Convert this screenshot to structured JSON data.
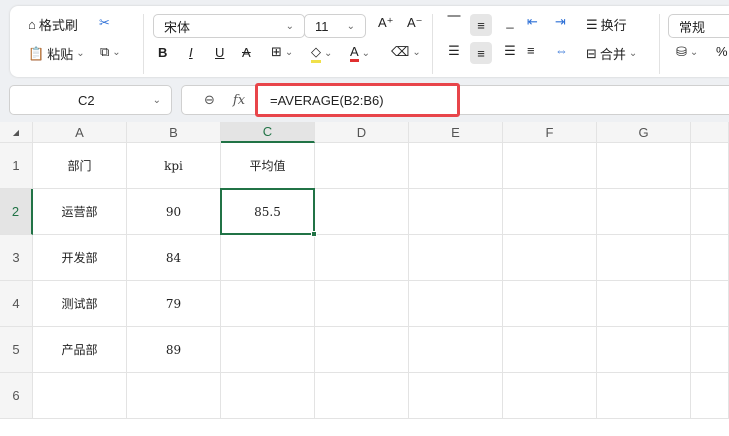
{
  "toolbar": {
    "format_painter": "格式刷",
    "paste": "粘贴",
    "font_name": "宋体",
    "font_size": "11",
    "bold": "B",
    "italic": "I",
    "underline": "U",
    "strike": "A",
    "grow": "A⁺",
    "shrink": "A⁻",
    "wrap": "换行",
    "merge": "合并",
    "number_format": "常规",
    "percent": "%"
  },
  "formula_bar": {
    "name_box": "C2",
    "fx": "fx",
    "formula": "=AVERAGE(B2:B6)"
  },
  "columns": [
    "A",
    "B",
    "C",
    "D",
    "E",
    "F",
    "G"
  ],
  "rows": [
    "1",
    "2",
    "3",
    "4",
    "5",
    "6"
  ],
  "cells": [
    [
      "部门",
      "kpi",
      "平均值"
    ],
    [
      "运营部",
      "90",
      "85.5"
    ],
    [
      "开发部",
      "84",
      ""
    ],
    [
      "测试部",
      "79",
      ""
    ],
    [
      "产品部",
      "89",
      ""
    ],
    [
      "",
      "",
      ""
    ]
  ],
  "colors": {
    "accent": "#217346",
    "highlight": "#f0e04a",
    "font_color": "#e03030",
    "formula_outline": "#e8454a"
  }
}
